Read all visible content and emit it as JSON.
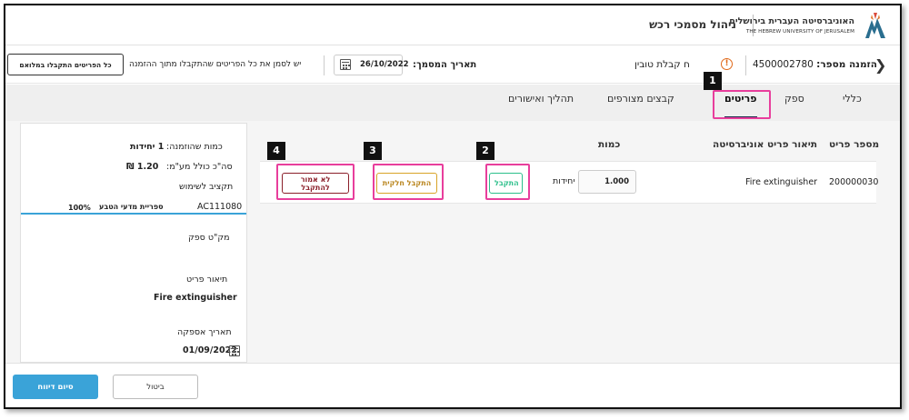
{
  "header": {
    "university_he": "האוניברסיטה העברית בירושלים",
    "university_en": "THE HEBREW UNIVERSITY OF JERUSALEM",
    "app_title": "ניהול מסמכי רכש",
    "logo_icon": "hebrew-university-logo-icon"
  },
  "subheader": {
    "order_label": "הזמנה מספר:",
    "order_number": "4500002780",
    "receipt_link": "ח קבלת טובין",
    "doc_date_label": "תאריך המסמך:",
    "doc_date": "26/10/2022",
    "must_mark_text": "יש לסמן את כל הפריטים שהתקבלו מתוך ההזמנה",
    "all_received_button": "כל הפריטים התקבלו במלואם"
  },
  "tabs": [
    {
      "label": "כללי"
    },
    {
      "label": "ספק"
    },
    {
      "label": "פריטים"
    },
    {
      "label": "קבצים מצורפים"
    },
    {
      "label": "תהליך ואישורים"
    }
  ],
  "items": {
    "headers": {
      "item_no": "מספר פריט",
      "description": "תיאור פריט אוניברסיטה",
      "quantity": "כמות"
    },
    "rows": [
      {
        "item_no": "200000030",
        "description": "Fire extinguisher",
        "quantity": "1.000",
        "units": "יחידות",
        "btn_received": "התקבל",
        "btn_partial": "התקבל חלקית",
        "btn_not": "לא אמור להתקבל"
      }
    ]
  },
  "annotations": [
    "1",
    "2",
    "3",
    "4"
  ],
  "side": {
    "ordered_qty_label": "כמות שהוזמנה:",
    "ordered_qty_value": "1 יחידות",
    "total_vat_label": "סה\"כ כולל מע\"מ:",
    "total_vat_value": "1.20 ₪",
    "budget_label": "תקציב לשימוש",
    "budget_code": "AC111080",
    "budget_name": "ספריית מדעי הטבע",
    "budget_pct": "100%",
    "supplier_sku_label": "מק\"ט ספק",
    "item_desc_label": "תיאור פריט",
    "item_desc_value": "Fire extinguisher",
    "supply_date_label": "תאריך אספקה",
    "supply_date_value": "01/09/2022"
  },
  "footer": {
    "finish_button": "סיום דיווח",
    "cancel_button": "ביטול"
  },
  "colors": {
    "accent_blue": "#3aa3d8",
    "highlight_pink": "#e83e9c",
    "received_green": "#2bbf8a",
    "partial_gold": "#d8a327",
    "not_received_red": "#8b1f2a"
  }
}
